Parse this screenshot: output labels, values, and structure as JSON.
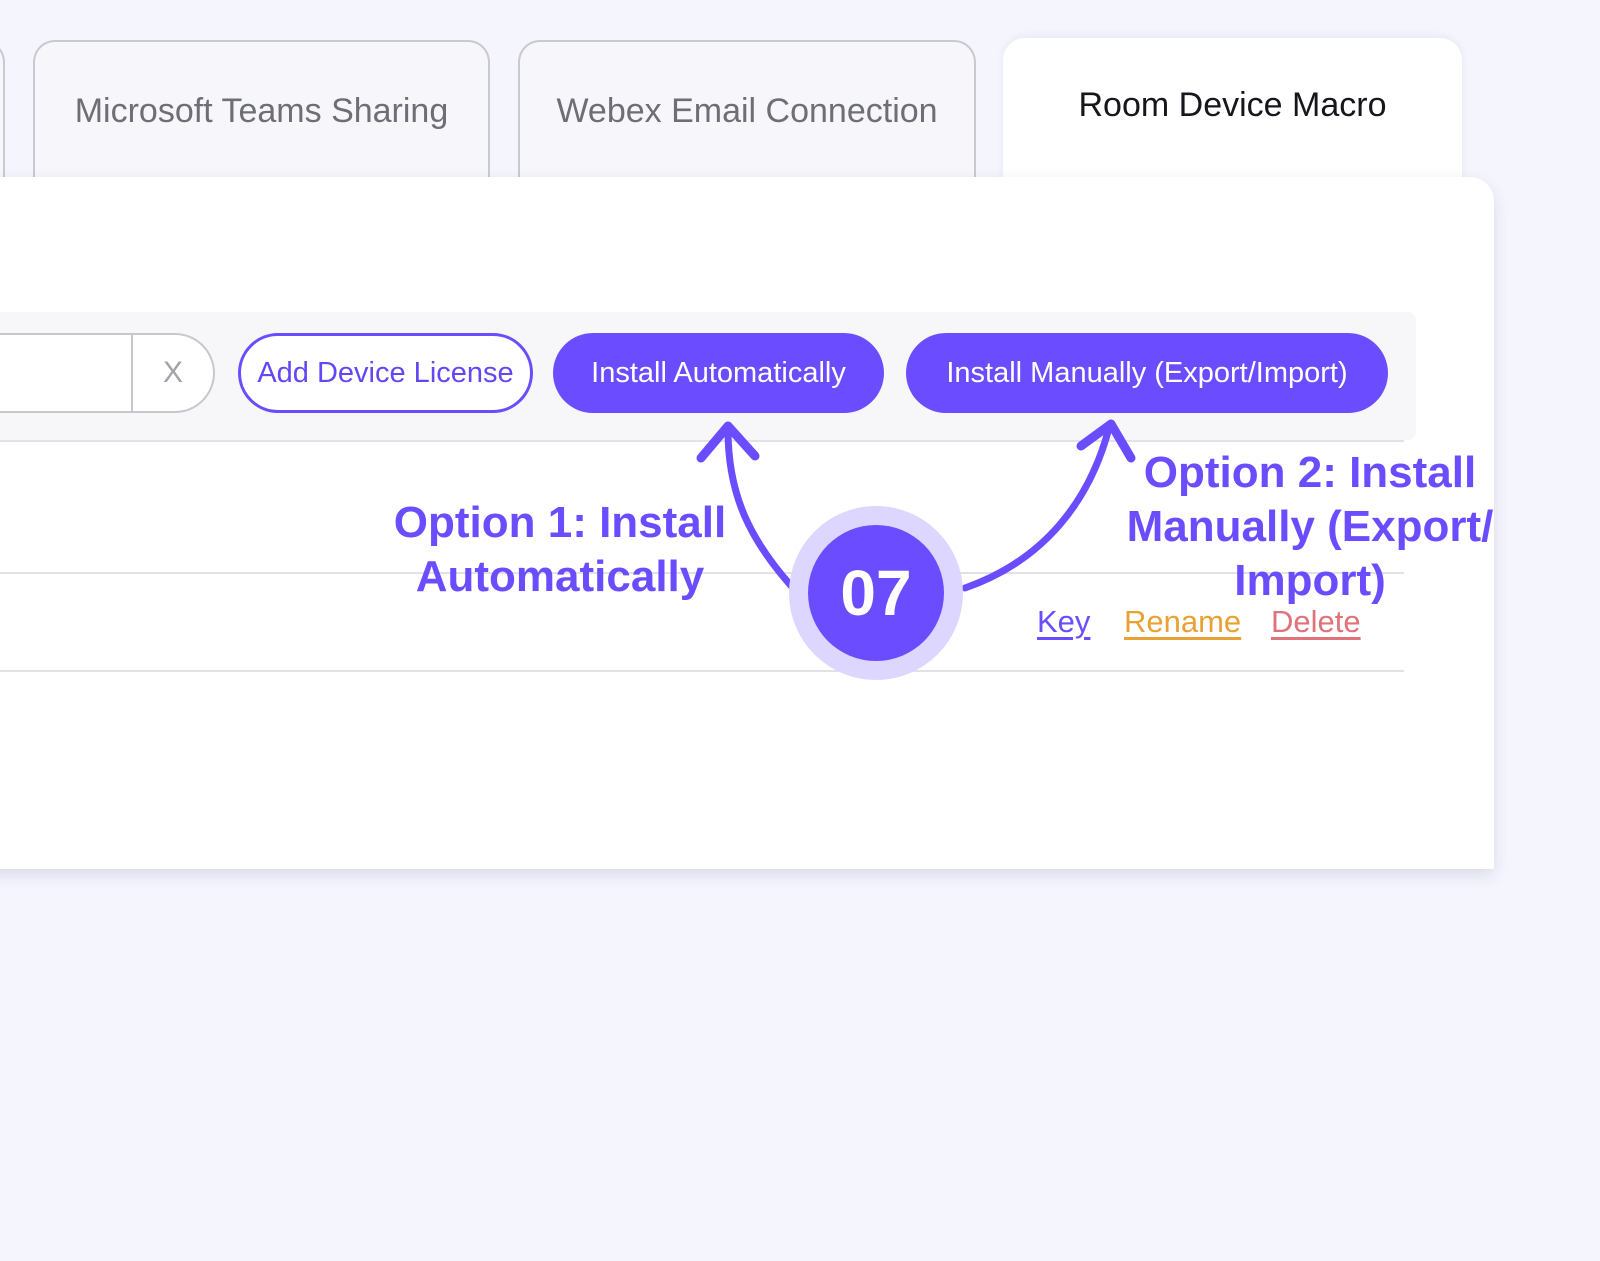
{
  "tabs": [
    {
      "label": ""
    },
    {
      "label": "Microsoft Teams Sharing"
    },
    {
      "label": "Webex Email Connection"
    },
    {
      "label": "Room Device Macro"
    }
  ],
  "toolbar": {
    "search_value": "",
    "search_clear": "X",
    "add_license_label": "Add Device License",
    "install_auto_label": "Install Automatically",
    "install_manual_label": "Install Manually (Export/Import)"
  },
  "row": {
    "key_label": "Key",
    "rename_label": "Rename",
    "delete_label": "Delete"
  },
  "annotations": {
    "step_number": "07",
    "option1_line1": "Option 1: Install",
    "option1_line2": "Automatically",
    "option2_line1": "Option 2: Install",
    "option2_line2": "Manually (Export/",
    "option2_line3": "Import)"
  },
  "colors": {
    "accent": "#6b4dff",
    "accent_light": "#ddd6fe",
    "rename": "#e8a233",
    "delete": "#e0727a",
    "page_background": "#f4f5fd"
  }
}
